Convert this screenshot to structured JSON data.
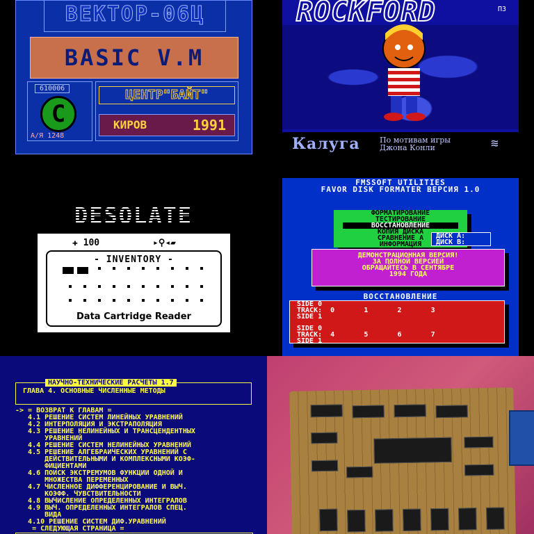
{
  "vector": {
    "title": "ВЕКТОР-06Ц",
    "basic": "BASIC V.M",
    "number": "610006",
    "logo_letter": "C",
    "po_box": "А/Я 1248",
    "center": "ЦЕНТР\"БАЙТ\"",
    "city": "КИРОВ",
    "year": "1991",
    "colors": {
      "frame": "#0b2fa6",
      "basic_bg": "#c8704c",
      "logo": "#1a9a1a",
      "accent": "#ffd040"
    }
  },
  "rockford": {
    "title": "ROCKFORD",
    "version": "ПЗ",
    "city": "Калуга",
    "credit_line1": "По мотивам игры",
    "credit_line2": "Джона Конли",
    "logo_icon": "zigzag-logo-icon"
  },
  "desolate": {
    "title": "DESOLATE",
    "ammo": "100",
    "ammo_icon": "ammo-icon",
    "tools_icon": "tools-icon",
    "inventory": "- INVENTORY -",
    "reader": "Data Cartridge Reader"
  },
  "fms": {
    "header1": "FMSSOFT   UTILITIES",
    "header2": "FAVOR DISK FORMATER ВЕРСИЯ 1.0",
    "menu": [
      "ФОРМАТИРОВАНИЕ",
      "ТЕСТИРОВАНИЕ",
      "ВОССТАНОВЛЕНИЕ",
      "КОПИЯ ДИСКА",
      "СРАВНЕНИЕ А",
      "ИНФОРМАЦИЯ"
    ],
    "disk_a": "ДИСК А:",
    "disk_b": "ДИСК B:",
    "demo1": "ДЕМОНСТРАЦИОННАЯ ВЕРСИЯ!",
    "demo2": "ЗА ПОЛНОЙ ВЕРСИЕЙ",
    "demo3": "ОБРАЩАЙТЕСЬ В СЕНТЯБРЕ",
    "demo4": "1994 ГОДА",
    "section": "ВОССТАНОВЛЕНИЕ",
    "tracks_top": "SIDE 0\nTRACK:  0       1       2       3\nSIDE 1",
    "tracks_bottom": "SIDE 0\nTRACK:  4       5       6       7\nSIDE 1"
  },
  "science": {
    "title": "НАУЧНО-ТЕХНИЧЕСКИЕ РАСЧЕТЫ 1.7",
    "chapter": "ГЛАВА 4.   ОСНОВНЫЕ ЧИСЛЕННЫЕ МЕТОДЫ",
    "list": "-> = ВОЗВРАТ К ГЛАВАМ =\n   4.1 РЕШЕНИЕ СИСТЕМ ЛИНЕЙНЫХ УРАВНЕНИЙ\n   4.2 ИНТЕРПОЛЯЦИЯ И ЭКСТРАПОЛЯЦИЯ\n   4.3 РЕШЕНИЕ НЕЛИНЕЙНЫХ И ТРАНСЦЕНДЕНТНЫХ\n       УРАВНЕНИЙ\n   4.4 РЕШЕНИЕ СИСТЕМ НЕЛИНЕЙНЫХ УРАВНЕНИЙ\n   4.5 РЕШЕНИЕ АЛГЕБРАИЧЕСКИХ УРАВНЕНИЙ С\n       ДЕЙСТВИТЕЛЬНЫМИ И КОМПЛЕКСНЫМИ КОЭФ-\n       ФИЦИЕНТАМИ\n   4.6 ПОИСК ЭКСТРЕМУМОВ ФУНКЦИИ ОДНОЙ И\n       МНОЖЕСТВА ПЕРЕМЕННЫХ\n   4.7 ЧИСЛЕННОЕ ДИФФЕРЕНЦИРОВАНИЕ И ВЫЧ.\n       КОЭФФ. ЧУВСТВИТЕЛЬНОСТИ\n   4.8 ВЫЧИСЛЕНИЕ ОПРЕДЕЛЕННЫХ ИНТЕГРАЛОВ\n   4.9 ВЫЧ. ОПРЕДЕЛЕННЫХ ИНТЕГРАЛОВ СПЕЦ.\n       ВИДА\n   4.10 РЕШЕНИЕ СИСТЕМ ДИФ.УРАВНЕНИЙ\n    = СЛЕДУЮЩАЯ СТРАНИЦА ="
  }
}
